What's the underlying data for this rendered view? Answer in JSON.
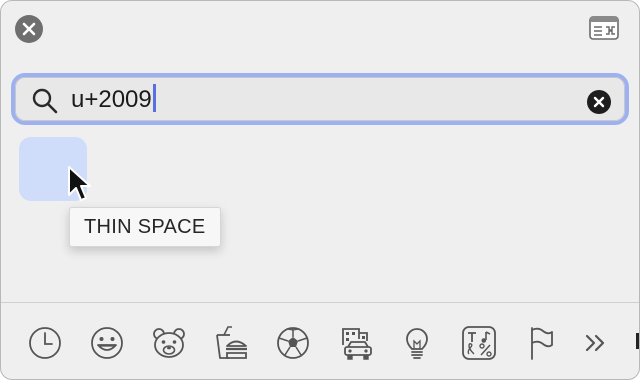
{
  "search": {
    "value": "u+2009",
    "placeholder": "Search"
  },
  "result": {
    "tooltip": "THIN SPACE"
  },
  "categories": [
    {
      "name": "frequently-used",
      "icon": "clock-icon"
    },
    {
      "name": "smileys-people",
      "icon": "smiley-icon"
    },
    {
      "name": "animals-nature",
      "icon": "bear-icon"
    },
    {
      "name": "food-drink",
      "icon": "burger-drink-icon"
    },
    {
      "name": "activity",
      "icon": "soccer-ball-icon"
    },
    {
      "name": "travel-places",
      "icon": "car-building-icon"
    },
    {
      "name": "objects",
      "icon": "lightbulb-icon"
    },
    {
      "name": "symbols",
      "icon": "symbols-icon"
    },
    {
      "name": "flags",
      "icon": "flag-icon"
    },
    {
      "name": "more",
      "icon": "chevrons-right-icon"
    }
  ],
  "colors": {
    "search_focus_ring": "#9db0f2",
    "result_highlight": "#cfdcfa",
    "caret": "#5b6ee0"
  }
}
